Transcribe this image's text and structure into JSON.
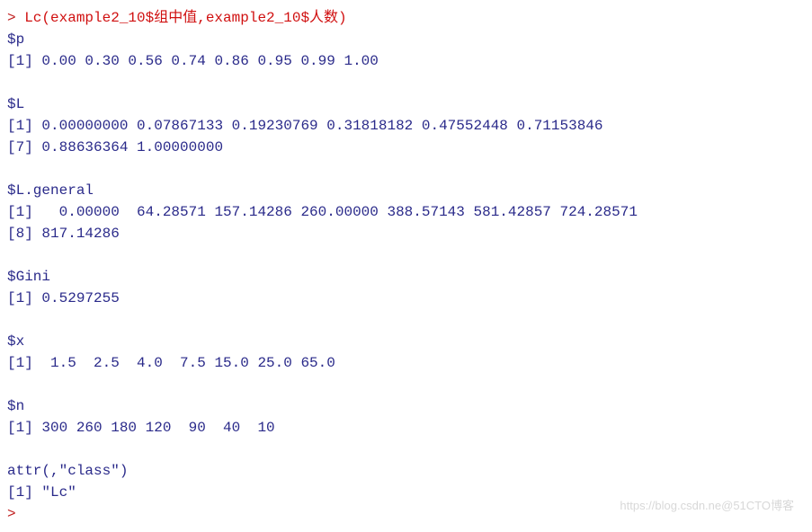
{
  "command_line": {
    "prompt": "> ",
    "command": "Lc(example2_10$组中值,example2_10$人数)"
  },
  "output": {
    "p_label": "$p",
    "p_values": "[1] 0.00 0.30 0.56 0.74 0.86 0.95 0.99 1.00",
    "L_label": "$L",
    "L_line1": "[1] 0.00000000 0.07867133 0.19230769 0.31818182 0.47552448 0.71153846",
    "L_line2": "[7] 0.88636364 1.00000000",
    "L_general_label": "$L.general",
    "L_general_line1": "[1]   0.00000  64.28571 157.14286 260.00000 388.57143 581.42857 724.28571",
    "L_general_line2": "[8] 817.14286",
    "Gini_label": "$Gini",
    "Gini_value": "[1] 0.5297255",
    "x_label": "$x",
    "x_values": "[1]  1.5  2.5  4.0  7.5 15.0 25.0 65.0",
    "n_label": "$n",
    "n_values": "[1] 300 260 180 120  90  40  10",
    "attr_label": "attr(,\"class\")",
    "attr_value": "[1] \"Lc\"",
    "final_prompt": ">"
  },
  "watermark": "https://blog.csdn.ne@51CTO博客"
}
